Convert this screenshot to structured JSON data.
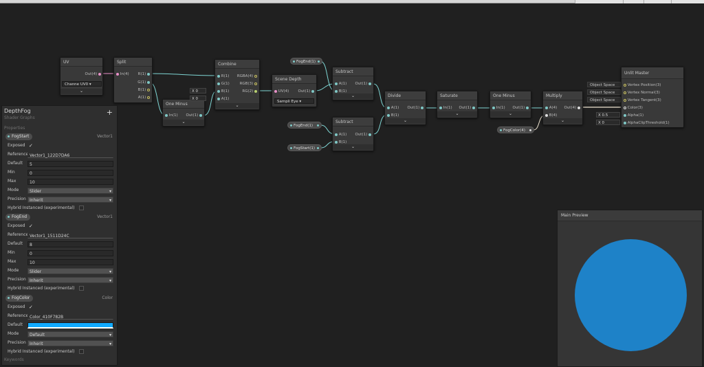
{
  "graph": {
    "nodes": {
      "uv": {
        "title": "UV",
        "out": "Out(4)",
        "channel_label": "Channe",
        "channel_value": "UV0"
      },
      "split": {
        "title": "Split",
        "in": "In(4)",
        "r": "R(1)",
        "g": "G(1)",
        "b": "B(1)",
        "a": "A(1)"
      },
      "one_minus_1": {
        "title": "One Minus",
        "in": "In(1)",
        "out": "Out(1)"
      },
      "combine": {
        "title": "Combine",
        "r": "R(1)",
        "g": "G(1)",
        "b": "B(1)",
        "a": "A(1)",
        "rgba": "RGBA(4)",
        "rgb": "RGB(3)",
        "rg": "RG(2)",
        "x_label": "X",
        "x1_value": "0",
        "x2_value": "0"
      },
      "scene_depth": {
        "title": "Scene Depth",
        "in": "UV(4)",
        "out": "Out(1)",
        "sampling_label": "Sampli",
        "sampling_value": "Eye"
      },
      "subtract_1": {
        "title": "Subtract",
        "a": "A(1)",
        "b": "B(1)",
        "out": "Out(1)"
      },
      "subtract_2": {
        "title": "Subtract",
        "a": "A(1)",
        "b": "B(1)",
        "out": "Out(1)"
      },
      "divide": {
        "title": "Divide",
        "a": "A(1)",
        "b": "B(1)",
        "out": "Out(1)"
      },
      "saturate": {
        "title": "Saturate",
        "in": "In(1)",
        "out": "Out(1)"
      },
      "one_minus_2": {
        "title": "One Minus",
        "in": "In(1)",
        "out": "Out(1)"
      },
      "multiply": {
        "title": "Multiply",
        "a": "A(4)",
        "b": "B(4)",
        "out": "Out(4)"
      },
      "unlit_master": {
        "title": "Unlit Master",
        "ports": [
          "Vertex Position(3)",
          "Vertex Normal(3)",
          "Vertex Tangent(3)",
          "Color(3)",
          "Alpha(1)",
          "AlphaClipThreshold(1)"
        ],
        "space_labels": [
          "Object Space",
          "Object Space",
          "Object Space"
        ],
        "alpha_x": "X",
        "alpha_value": "0.5",
        "clip_x": "X",
        "clip_value": "0"
      }
    },
    "property_nodes": {
      "fog_end_1": "FogEnd(1)",
      "fog_end_2": "FogEnd(1)",
      "fog_start": "FogStart(1)",
      "fog_color": "FogColor(4)"
    }
  },
  "blackboard": {
    "title": "DepthFog",
    "subtitle": "Shader Graphs",
    "add_label": "+",
    "properties_label": "Properties",
    "keywords_label": "Keywords",
    "properties": [
      {
        "name": "FogStart",
        "type": "Vector1",
        "exposed_label": "Exposed",
        "exposed_check": "✓",
        "reference_label": "Reference",
        "reference": "Vector1_122D7DA6",
        "default_label": "Default",
        "default": "5",
        "min_label": "Min",
        "min": "0",
        "max_label": "Max",
        "max": "10",
        "mode_label": "Mode",
        "mode": "Slider",
        "precision_label": "Precision",
        "precision": "Inherit",
        "hybrid_label": "Hybrid Instanced (experimental)"
      },
      {
        "name": "FogEnd",
        "type": "Vector1",
        "exposed_label": "Exposed",
        "exposed_check": "✓",
        "reference_label": "Reference",
        "reference": "Vector1_1511D24C",
        "default_label": "Default",
        "default": "8",
        "min_label": "Min",
        "min": "0",
        "max_label": "Max",
        "max": "10",
        "mode_label": "Mode",
        "mode": "Slider",
        "precision_label": "Precision",
        "precision": "Inherit",
        "hybrid_label": "Hybrid Instanced (experimental)"
      },
      {
        "name": "FogColor",
        "type": "Color",
        "exposed_label": "Exposed",
        "exposed_check": "✓",
        "reference_label": "Reference",
        "reference": "Color_410F782B",
        "default_label": "Default",
        "default_color": "#10aaff",
        "mode_label": "Mode",
        "mode": "Default",
        "precision_label": "Precision",
        "precision": "Inherit",
        "hybrid_label": "Hybrid Instanced (experimental)"
      }
    ]
  },
  "preview": {
    "title": "Main Preview",
    "sphere_color": "#1e82c8"
  },
  "colors": {
    "canvas": "#202020",
    "wire_float": "#7fd6d4",
    "wire_vector": "#f0e6d2",
    "uv_wire": "#e890c8"
  }
}
